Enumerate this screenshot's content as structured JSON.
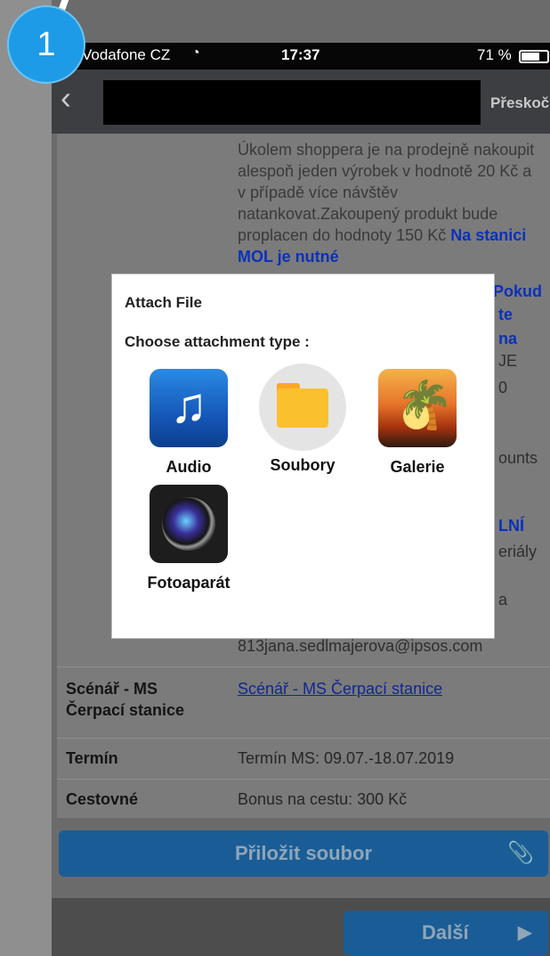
{
  "badge": {
    "number": "1"
  },
  "status_bar": {
    "carrier": "Vodafone CZ",
    "wifi_icon": "wifi-icon",
    "time": "17:37",
    "battery": "71 %"
  },
  "nav": {
    "back_icon": "chevron-left-icon",
    "skip": "Přeskoč"
  },
  "content": {
    "description": "Úkolem shoppera je na prodejně nakoupit alespoň jeden výrobek v hodnotě 20 Kč a v případě více návštěv natankovat.Zakoupený produkt bude proplacen do hodnoty",
    "desc_tail": "150 Kč",
    "desc_blue": "Na stanici MOL je nutné",
    "peek": [
      "Pokud",
      "te",
      "na",
      "JE",
      "0",
      "ounts",
      "LNÍ",
      "eriály",
      "a"
    ],
    "email": "813jana.sedlmajerova@ipsos.com",
    "rows": [
      {
        "label": "Scénář - MS Čerpací stanice",
        "value": "Scénář - MS Čerpací stanice"
      },
      {
        "label": "Termín",
        "value": "Termín MS: 09.07.-18.07.2019"
      },
      {
        "label": "Cestovné",
        "value": "Bonus na cestu: 300 Kč"
      }
    ]
  },
  "attach_button": {
    "label": "Přiložit soubor",
    "icon": "paperclip-icon"
  },
  "next_button": {
    "label": "Další",
    "icon": "play-arrow-icon"
  },
  "dialog": {
    "title": "Attach File",
    "subtitle": "Choose attachment type :",
    "options": [
      {
        "label": "Audio",
        "icon": "music-note-icon"
      },
      {
        "label": "Soubory",
        "icon": "folder-icon"
      },
      {
        "label": "Galerie",
        "icon": "gallery-palm-icon"
      },
      {
        "label": "Fotoaparát",
        "icon": "camera-icon"
      }
    ]
  },
  "colors": {
    "accent": "#1a5d96",
    "badge": "#1e9be6",
    "link": "#10288c"
  }
}
